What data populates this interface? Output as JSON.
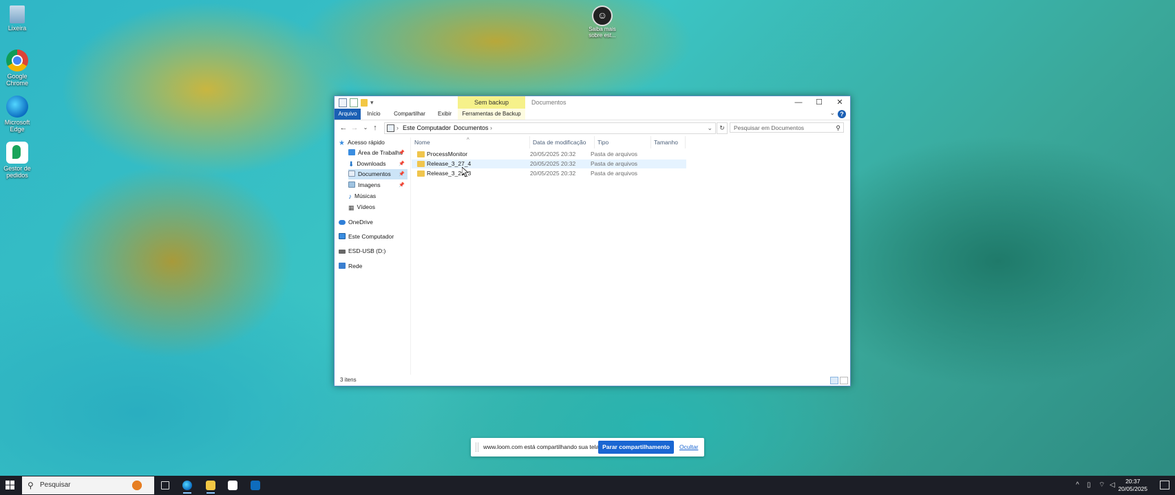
{
  "desktop": {
    "icons": [
      {
        "label": "Lixeira",
        "icon": "recycle-bin-icon"
      },
      {
        "label": "Google Chrome",
        "icon": "chrome-icon"
      },
      {
        "label": "Microsoft Edge",
        "icon": "edge-icon"
      },
      {
        "label": "Gestor de pedidos",
        "icon": "gestor-icon"
      }
    ],
    "shortcut_label": "Saiba mais sobre est..."
  },
  "explorer": {
    "context_tab": "Sem backup",
    "window_title": "Documentos",
    "ribbon_tabs": [
      "Arquivo",
      "Início",
      "Compartilhar",
      "Exibir",
      "Ferramentas de Backup"
    ],
    "breadcrumb": [
      "Este Computador",
      "Documentos"
    ],
    "search_placeholder": "Pesquisar em Documentos",
    "nav_items": [
      {
        "label": "Acesso rápido",
        "icon": "star-icon"
      },
      {
        "label": "Área de Trabalho",
        "icon": "desktop-folder-icon",
        "pinned": true
      },
      {
        "label": "Downloads",
        "icon": "download-arrow-icon",
        "pinned": true
      },
      {
        "label": "Documentos",
        "icon": "document-folder-icon",
        "pinned": true,
        "selected": true
      },
      {
        "label": "Imagens",
        "icon": "pictures-folder-icon",
        "pinned": true
      },
      {
        "label": "Músicas",
        "icon": "music-note-icon"
      },
      {
        "label": "Vídeos",
        "icon": "video-icon"
      },
      {
        "label": "OneDrive",
        "icon": "cloud-icon"
      },
      {
        "label": "Este Computador",
        "icon": "computer-icon"
      },
      {
        "label": "ESD-USB (D:)",
        "icon": "usb-drive-icon"
      },
      {
        "label": "Rede",
        "icon": "network-icon"
      }
    ],
    "columns": [
      "Nome",
      "Data de modificação",
      "Tipo",
      "Tamanho"
    ],
    "files": [
      {
        "name": "ProcessMonitor",
        "date": "20/05/2025 20:32",
        "type": "Pasta de arquivos",
        "size": ""
      },
      {
        "name": "Release_3_27_4",
        "date": "20/05/2025 20:32",
        "type": "Pasta de arquivos",
        "size": ""
      },
      {
        "name": "Release_3_29_3",
        "date": "20/05/2025 20:32",
        "type": "Pasta de arquivos",
        "size": ""
      }
    ],
    "status": "3 itens"
  },
  "share_bar": {
    "message": "www.loom.com está compartilhando sua tela.",
    "stop_label": "Parar compartilhamento",
    "hide_label": "Ocultar"
  },
  "taskbar": {
    "search_placeholder": "Pesquisar",
    "time": "20:37",
    "date": "20/05/2025"
  }
}
